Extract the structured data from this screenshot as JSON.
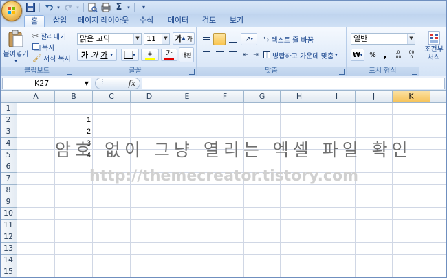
{
  "title_bar": {
    "qat": {
      "save": "save-icon",
      "undo": "undo-icon",
      "redo": "redo-icon",
      "print_preview": "print-preview-icon",
      "sum": "Σ",
      "customize": "▾"
    }
  },
  "tabs": [
    "홈",
    "삽입",
    "페이지 레이아웃",
    "수식",
    "데이터",
    "검토",
    "보기"
  ],
  "active_tab": "홈",
  "ribbon": {
    "clipboard": {
      "paste": "붙여넣기",
      "cut": "잘라내기",
      "copy": "복사",
      "format_painter": "서식 복사",
      "label": "클립보드"
    },
    "font": {
      "font_name": "맑은 고딕",
      "font_size": "11",
      "grow": "가",
      "shrink": "가",
      "bold": "가",
      "italic": "가",
      "underline": "가",
      "font_color": "가",
      "phonetic": "내천",
      "label": "글꼴"
    },
    "alignment": {
      "wrap_text": "텍스트 줄 바꿈",
      "merge_center": "병합하고 가운데 맞춤",
      "label": "맞춤"
    },
    "number": {
      "format": "일반",
      "currency": "₩",
      "percent": "%",
      "comma": ",",
      "label": "표시 형식"
    },
    "styles": {
      "conditional_1": "조건부",
      "conditional_2": "서식"
    }
  },
  "formula_bar": {
    "name_box": "K27",
    "fx": "fx",
    "formula": ""
  },
  "grid": {
    "columns": [
      "A",
      "B",
      "C",
      "D",
      "E",
      "F",
      "G",
      "H",
      "I",
      "J",
      "K"
    ],
    "active_column": "K",
    "rows": [
      "1",
      "2",
      "3",
      "4",
      "5",
      "6",
      "7",
      "8",
      "9",
      "10",
      "11",
      "12",
      "13",
      "14",
      "15"
    ],
    "cells": {
      "B2": "1",
      "B3": "2",
      "B4": "3",
      "B5": "4"
    }
  },
  "overlay_caption": "암호 없이 그냥 열리는 엑셀 파일 확인",
  "watermark": "http://themecreator.tistory.com",
  "colors": {
    "ribbon_border": "#8db2e3",
    "selected_button": "#f9c44f",
    "font_color_bar": "#e00000",
    "highlight_bar": "#ffff00"
  }
}
